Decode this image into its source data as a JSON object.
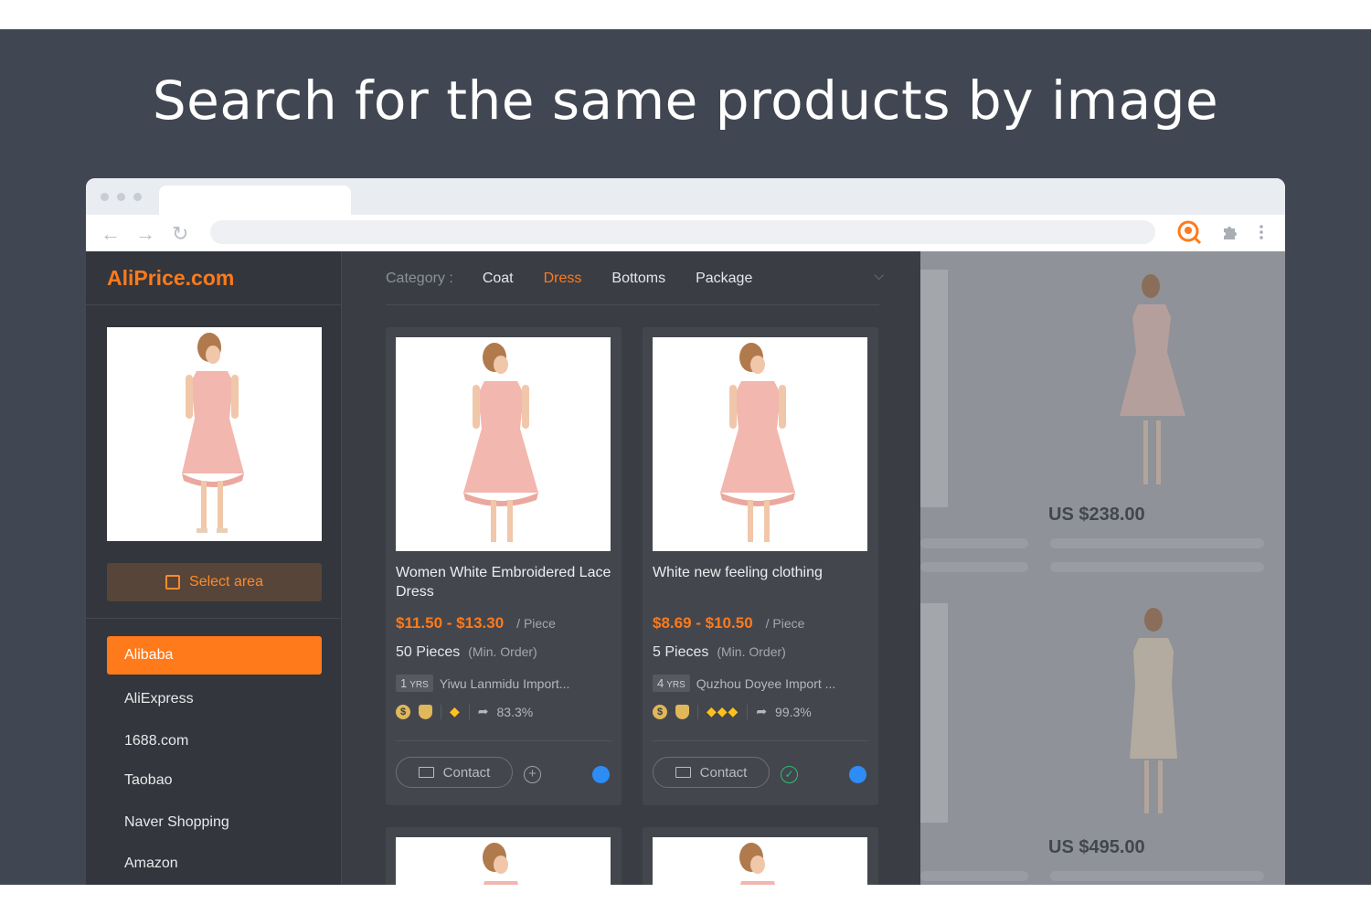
{
  "headline": "Search for the same products by image",
  "browser": {
    "extension_icon": "aliprice-extension-icon",
    "puzzle_icon": "puzzle-icon",
    "menu_icon": "kebab-menu-icon"
  },
  "sidebar": {
    "logo": "AliPrice.com",
    "select_area_label": "Select area",
    "sites": [
      "Alibaba",
      "AliExpress",
      "1688.com",
      "Taobao",
      "Naver Shopping",
      "Amazon"
    ],
    "active_site": "Alibaba"
  },
  "categories": {
    "label": "Category :",
    "items": [
      "Coat",
      "Dress",
      "Bottoms",
      "Package"
    ],
    "active": "Dress"
  },
  "cards": [
    {
      "title": "Women White Embroidered Lace Dress",
      "price": "$11.50 - $13.30",
      "unit": "/ Piece",
      "moq": "50 Pieces",
      "moq_note": "(Min. Order)",
      "years": "1",
      "years_unit": "YRS",
      "supplier": "Yiwu Lanmidu Import...",
      "gems": "◆",
      "response_rate": "83.3%",
      "contact_label": "Contact",
      "added": false
    },
    {
      "title": "White new feeling clothing",
      "price": "$8.69 - $10.50",
      "unit": "/ Piece",
      "moq": "5 Pieces",
      "moq_note": "(Min. Order)",
      "years": "4",
      "years_unit": "YRS",
      "supplier": "Quzhou Doyee Import ...",
      "gems": "◆◆◆",
      "response_rate": "99.3%",
      "contact_label": "Contact",
      "added": true
    }
  ],
  "background_prices": [
    "US $238.00",
    "US $495.00"
  ],
  "colors": {
    "accent": "#ff7a1a",
    "background": "#414752",
    "panel": "#3a3d44",
    "success": "#2fbf71",
    "chat": "#2e8cf5"
  }
}
